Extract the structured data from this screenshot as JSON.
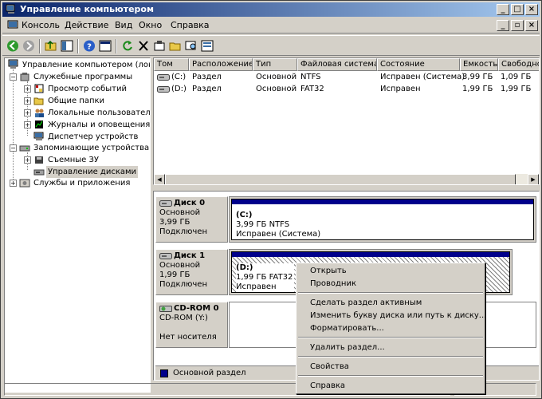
{
  "window": {
    "title": "Управление компьютером"
  },
  "menu": [
    "Консоль",
    "Действие",
    "Вид",
    "Окно",
    "Справка"
  ],
  "tree": {
    "root": "Управление компьютером (локаль",
    "items": [
      "Служебные программы",
      "Просмотр событий",
      "Общие папки",
      "Локальные пользователи",
      "Журналы и оповещения пр",
      "Диспетчер устройств",
      "Запоминающие устройства",
      "Съемные ЗУ",
      "Управление дисками",
      "Службы и приложения"
    ]
  },
  "volumes": {
    "columns": [
      "Том",
      "Расположение",
      "Тип",
      "Файловая система",
      "Состояние",
      "Емкость",
      "Свободно"
    ],
    "rows": [
      [
        "(C:)",
        "Раздел",
        "Основной",
        "NTFS",
        "Исправен (Система)",
        "3,99 ГБ",
        "1,09 ГБ"
      ],
      [
        "(D:)",
        "Раздел",
        "Основной",
        "FAT32",
        "Исправен",
        "1,99 ГБ",
        "1,99 ГБ"
      ]
    ]
  },
  "disks": [
    {
      "name": "Диск 0",
      "type": "Основной",
      "size": "3,99 ГБ",
      "status": "Подключен",
      "part": {
        "label": "(C:)",
        "info": "3,99 ГБ NTFS",
        "state": "Исправен (Система)"
      }
    },
    {
      "name": "Диск 1",
      "type": "Основной",
      "size": "1,99 ГБ",
      "status": "Подключен",
      "part": {
        "label": "(D:)",
        "info": "1,99 ГБ FAT32",
        "state": "Исправен"
      }
    },
    {
      "name": "CD-ROM 0",
      "type": "CD-ROM (Y:)",
      "status": "Нет носителя"
    }
  ],
  "legend": "Основной раздел",
  "context_menu": [
    "Открыть",
    "Проводник",
    "Сделать раздел активным",
    "Изменить букву диска или путь к диску...",
    "Форматировать...",
    "Удалить раздел...",
    "Свойства",
    "Справка"
  ],
  "colors": {
    "primary_partition": "#00008b",
    "title_start": "#0a246a",
    "title_end": "#a6caf0"
  }
}
